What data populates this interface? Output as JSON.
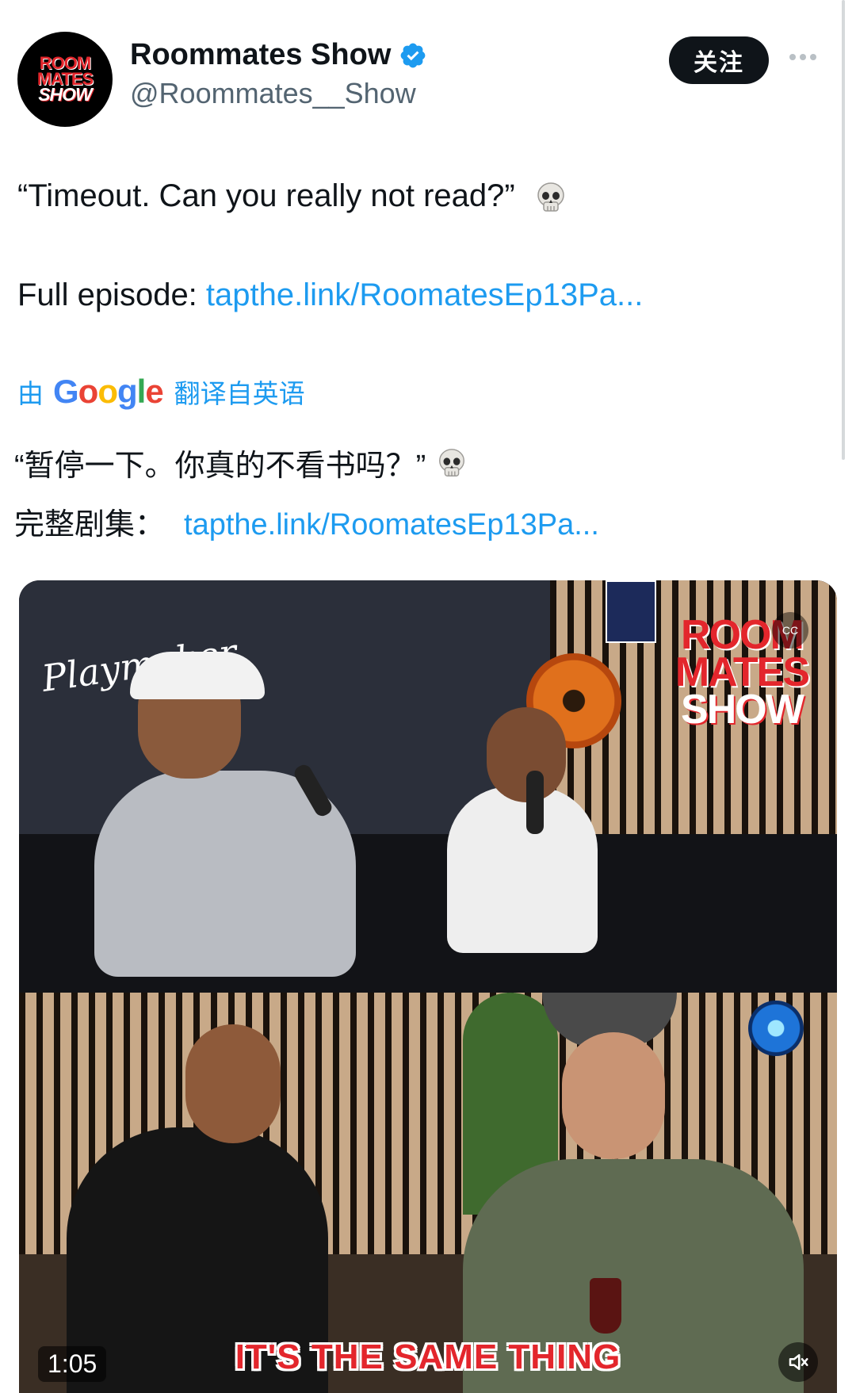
{
  "author": {
    "name": "Roommates Show",
    "handle": "@Roommates__Show",
    "avatar_text": [
      "ROOM",
      "MATES",
      "SHOW"
    ],
    "verified_icon": "verified-badge-icon"
  },
  "follow_label": "关注",
  "tweet": {
    "text": "“Timeout. Can you really not read?”",
    "emoji": "skull",
    "full_episode_label": "Full episode: ",
    "link": "tapthe.link/RoomatesEp13Pa..."
  },
  "translation": {
    "by_label": "由",
    "provider": "Google",
    "suffix": "翻译自英语",
    "text": "“暂停一下。你真的不看书吗？”",
    "full_episode_label": "完整剧集：",
    "link": "tapthe.link/RoomatesEp13Pa..."
  },
  "media": {
    "wall_logo": "Playmaker",
    "show_logo_lines": [
      "ROOM",
      "MATES",
      "SHOW"
    ],
    "caption": "IT'S THE SAME THING",
    "timestamp": "1:05",
    "cc_label": "CC",
    "mute_icon": "speaker-muted-icon"
  },
  "colors": {
    "link": "#1d9bf0",
    "follow_bg": "#0f1419",
    "caption_red": "#e3262c"
  }
}
